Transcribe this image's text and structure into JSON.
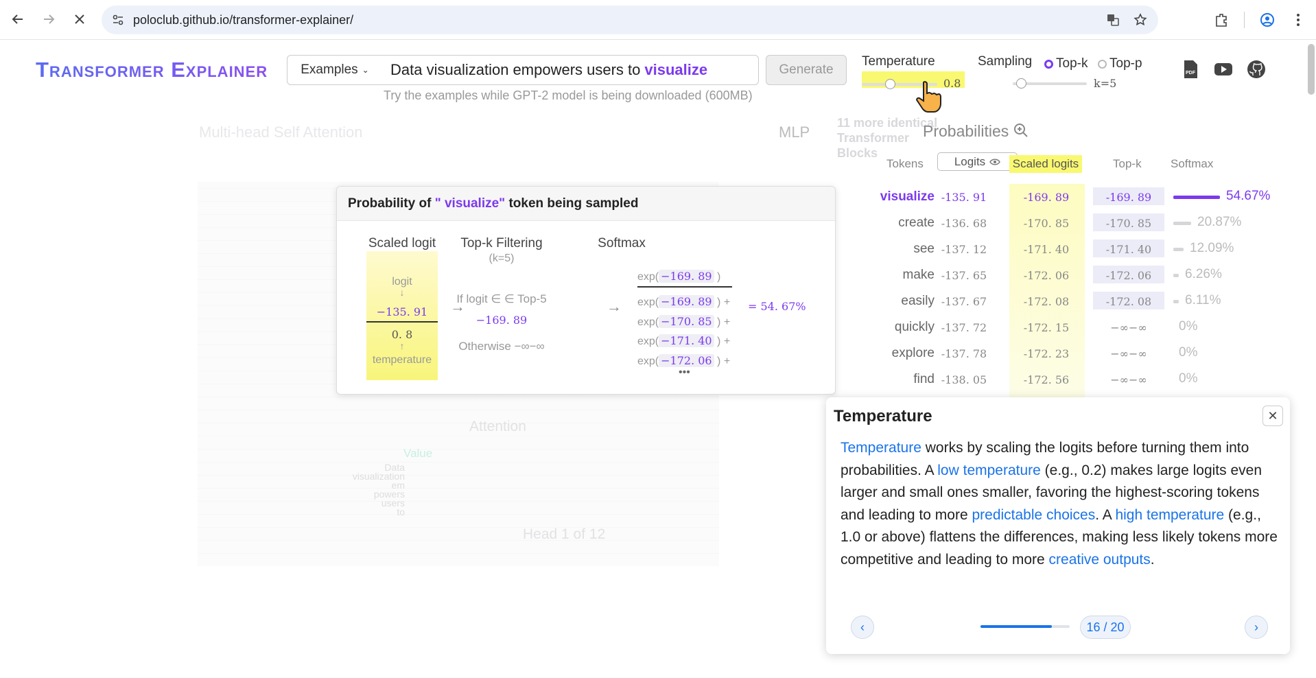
{
  "browser": {
    "url": "poloclub.github.io/transformer-explainer/"
  },
  "header": {
    "logo": "Transformer Explainer",
    "examples_label": "Examples",
    "prompt_text": "Data visualization empowers users to",
    "prompt_next_token": "visualize",
    "generate_label": "Generate",
    "hint": "Try the examples while GPT-2 model is being downloaded (600MB)",
    "temperature_label": "Temperature",
    "temperature_value": "0.8",
    "temperature_level": 0.28,
    "sampling_label": "Sampling",
    "topk_label": "Top-k",
    "topp_label": "Top-p",
    "k_value": "k=5"
  },
  "background": {
    "attention_title": "Multi-head Self Attention",
    "mlp": "MLP",
    "blocks_note_count": "11",
    "blocks_note": "more identical Transformer Blocks",
    "attention_label": "Attention",
    "value_label": "Value",
    "tokens": [
      "Data",
      "visualization",
      "em",
      "powers",
      "users",
      "to"
    ],
    "head_label": "Head 1 of 12"
  },
  "popup": {
    "title_prefix": "Probability of",
    "title_token": "\" visualize\"",
    "title_suffix": "token being sampled",
    "col1": "Scaled logit",
    "col2": "Top-k Filtering",
    "col2_sub": "(k=5)",
    "col3": "Softmax",
    "logit_label": "logit",
    "logit_value": "−135. 91",
    "temp_value": "0. 8",
    "temperature_label": "temperature",
    "if_text": "If logit  ∈ ∈ Top-5",
    "if_value": "−169. 89",
    "otherwise": "Otherwise −∞−∞",
    "exp": "exp(",
    "numerator": "−169. 89",
    "denominators": [
      "−169. 89",
      "−170. 85",
      "−171. 40",
      "−172. 06"
    ],
    "result": "= 54. 67%"
  },
  "probabilities": {
    "title": "Probabilities",
    "col_tokens": "Tokens",
    "col_logits": "Logits",
    "col_scaled": "Scaled logits",
    "col_topk": "Top-k",
    "col_softmax": "Softmax",
    "rows": [
      {
        "token": "visualize",
        "logit": "-135. 91",
        "scaled": "-169. 89",
        "topk": "-169. 89",
        "pct": "54.67%",
        "p": 0.5467
      },
      {
        "token": "create",
        "logit": "-136. 68",
        "scaled": "-170. 85",
        "topk": "-170. 85",
        "pct": "20.87%",
        "p": 0.2087
      },
      {
        "token": "see",
        "logit": "-137. 12",
        "scaled": "-171. 40",
        "topk": "-171. 40",
        "pct": "12.09%",
        "p": 0.1209
      },
      {
        "token": "make",
        "logit": "-137. 65",
        "scaled": "-172. 06",
        "topk": "-172. 06",
        "pct": "6.26%",
        "p": 0.0626
      },
      {
        "token": "easily",
        "logit": "-137. 67",
        "scaled": "-172. 08",
        "topk": "-172. 08",
        "pct": "6.11%",
        "p": 0.0611
      },
      {
        "token": "quickly",
        "logit": "-137. 72",
        "scaled": "-172. 15",
        "topk": "−∞−∞",
        "pct": "0%",
        "p": 0
      },
      {
        "token": "explore",
        "logit": "-137. 78",
        "scaled": "-172. 23",
        "topk": "−∞−∞",
        "pct": "0%",
        "p": 0
      },
      {
        "token": "find",
        "logit": "-138. 05",
        "scaled": "-172. 56",
        "topk": "−∞−∞",
        "pct": "0%",
        "p": 0
      }
    ]
  },
  "card": {
    "title": "Temperature",
    "seg": [
      {
        "t": "Temperature",
        "link": true
      },
      {
        "t": " works by scaling the logits before turning them into probabilities. A ",
        "link": false
      },
      {
        "t": "low temperature",
        "link": true
      },
      {
        "t": " (e.g., 0.2) makes large logits even larger and small ones smaller, favoring the highest-scoring tokens and leading to more ",
        "link": false
      },
      {
        "t": "predictable choices",
        "link": true
      },
      {
        "t": ". A ",
        "link": false
      },
      {
        "t": "high temperature",
        "link": true
      },
      {
        "t": " (e.g., 1.0 or above) flattens the differences, making less likely tokens more competitive and leading to more ",
        "link": false
      },
      {
        "t": "creative outputs",
        "link": true
      },
      {
        "t": ".",
        "link": false
      }
    ],
    "step": "16 / 20",
    "progress": 0.8
  }
}
